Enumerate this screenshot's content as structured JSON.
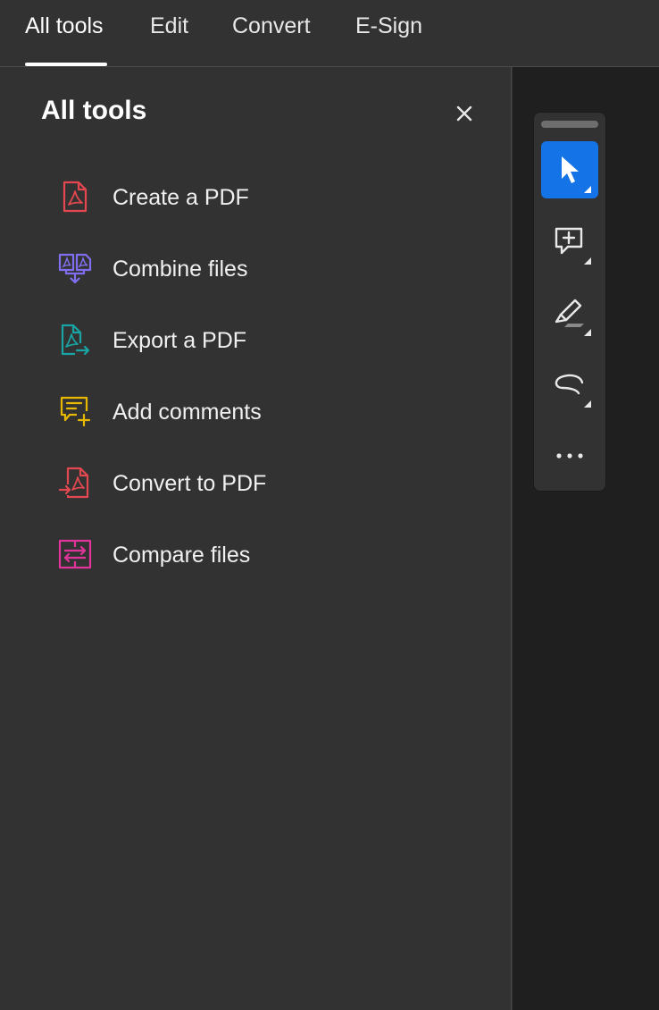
{
  "tabs": [
    {
      "label": "All tools",
      "active": true
    },
    {
      "label": "Edit",
      "active": false
    },
    {
      "label": "Convert",
      "active": false
    },
    {
      "label": "E-Sign",
      "active": false
    }
  ],
  "panel": {
    "title": "All tools",
    "close_icon": "close-icon",
    "tools": [
      {
        "label": "Create a PDF",
        "icon": "create-pdf-icon",
        "color": "#e34850"
      },
      {
        "label": "Combine files",
        "icon": "combine-files-icon",
        "color": "#7f6ef0"
      },
      {
        "label": "Export a PDF",
        "icon": "export-pdf-icon",
        "color": "#1aa3a3"
      },
      {
        "label": "Add comments",
        "icon": "add-comments-icon",
        "color": "#e6b800"
      },
      {
        "label": "Convert to PDF",
        "icon": "convert-to-pdf-icon",
        "color": "#e34850"
      },
      {
        "label": "Compare files",
        "icon": "compare-files-icon",
        "color": "#e0349a"
      }
    ]
  },
  "quick_toolbar": {
    "tools": [
      {
        "icon": "select-cursor-icon",
        "active": true
      },
      {
        "icon": "add-comment-icon",
        "active": false
      },
      {
        "icon": "highlight-pen-icon",
        "active": false
      },
      {
        "icon": "freehand-draw-icon",
        "active": false
      },
      {
        "icon": "more-options-icon",
        "active": false
      }
    ]
  },
  "colors": {
    "accent": "#1473e6",
    "panel_bg": "#323232",
    "canvas_bg": "#1f1f1f"
  }
}
